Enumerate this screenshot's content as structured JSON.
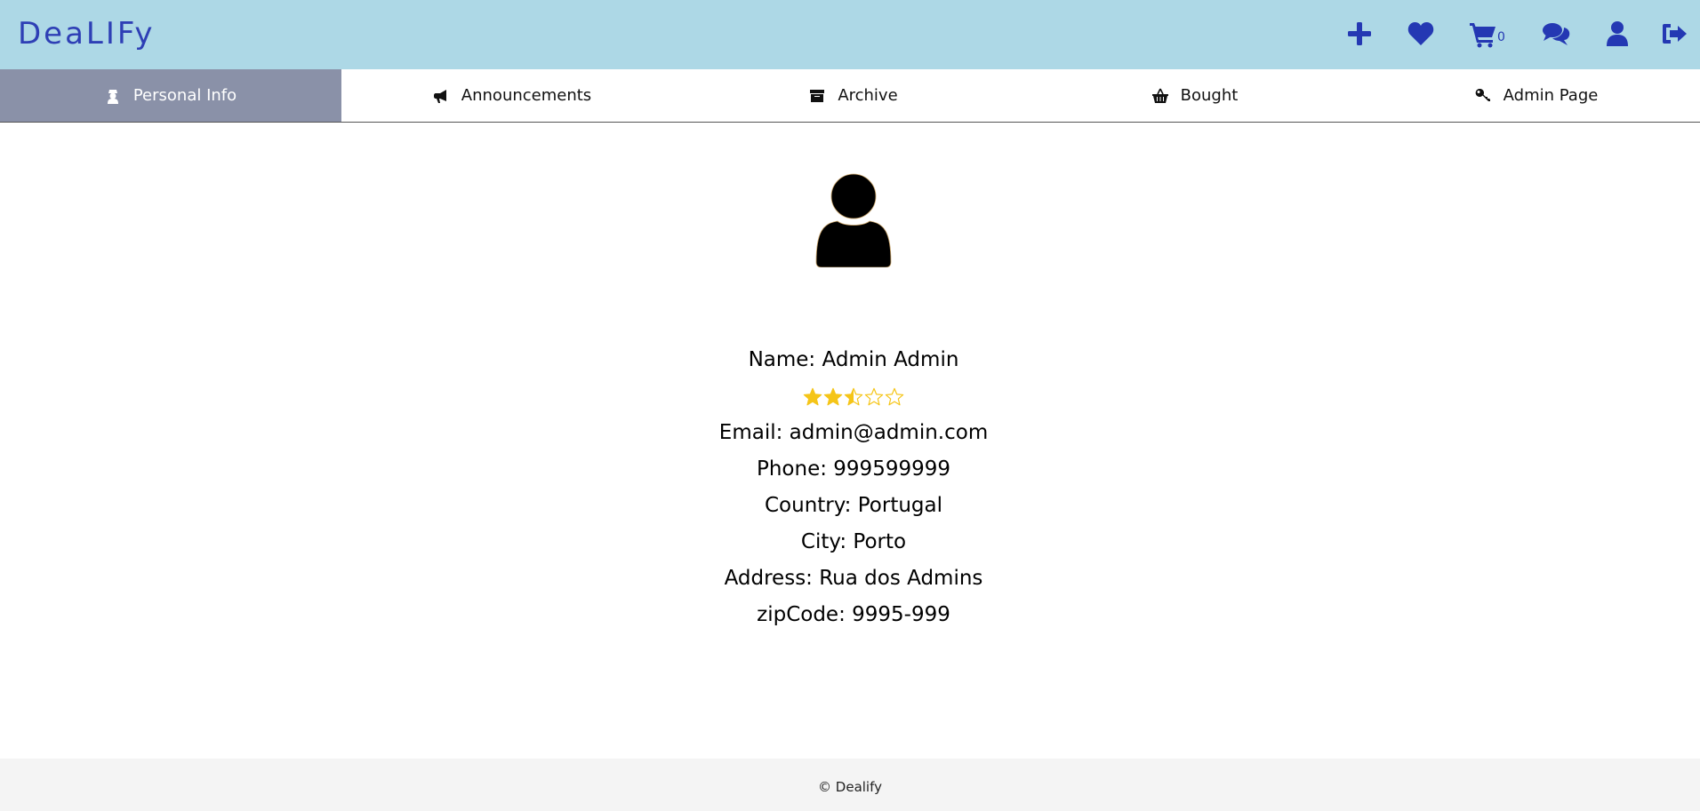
{
  "app": {
    "logo": "DeaLIFy"
  },
  "header": {
    "icons": [
      "plus-icon",
      "heart-icon",
      "cart-icon",
      "chat-icon",
      "user-icon",
      "sign-out-icon"
    ],
    "cart_count": "0",
    "accent_color": "#2438b3",
    "background": "#add8e6"
  },
  "tabs": [
    {
      "label": "Personal Info",
      "icon": "user-secret-icon",
      "active": true
    },
    {
      "label": "Announcements",
      "icon": "bullhorn-icon",
      "active": false
    },
    {
      "label": "Archive",
      "icon": "archive-icon",
      "active": false
    },
    {
      "label": "Bought",
      "icon": "basket-icon",
      "active": false
    },
    {
      "label": "Admin Page",
      "icon": "key-icon",
      "active": false
    }
  ],
  "profile": {
    "name": "Name: Admin Admin",
    "rating": 2.5,
    "rating_max": 5,
    "email": "Email: admin@admin.com",
    "phone": "Phone: 999599999",
    "country": "Country: Portugal",
    "city": "City: Porto",
    "address": "Address: Rua dos Admins",
    "zipcode": "zipCode: 9995-999",
    "star_color": "#f5c518"
  },
  "footer": {
    "text": "© Dealify"
  }
}
